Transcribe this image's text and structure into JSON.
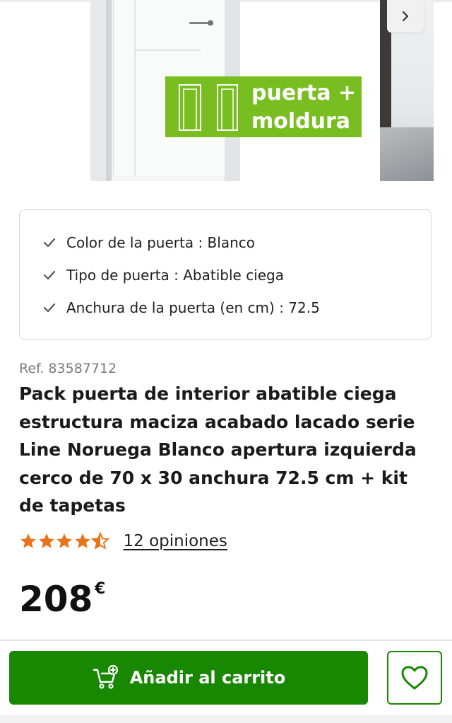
{
  "gallery": {
    "promo_line1": "puerta +",
    "promo_line2": "moldura",
    "next_icon": "chevron-right-icon"
  },
  "features": [
    {
      "text": "Color de la puerta : Blanco"
    },
    {
      "text": "Tipo de puerta : Abatible ciega"
    },
    {
      "text": "Anchura de la puerta (en cm) : 72.5"
    }
  ],
  "product": {
    "ref": "Ref. 83587712",
    "title": "Pack puerta de interior abatible ciega estructura maciza acabado lacado serie Line Noruega Blanco apertura izquierda cerco de 70 x 30 anchura 72.5 cm + kit de tapetas",
    "rating": 4.5,
    "reviews_label": "12 opiniones",
    "price": "208",
    "currency": "€"
  },
  "actions": {
    "add_to_cart_label": "Añadir al carrito",
    "cart_icon": "cart-add-icon",
    "favorite_icon": "heart-icon"
  },
  "colors": {
    "primary_green": "#188803",
    "promo_green": "#78be20",
    "star_orange": "#e8731b"
  }
}
